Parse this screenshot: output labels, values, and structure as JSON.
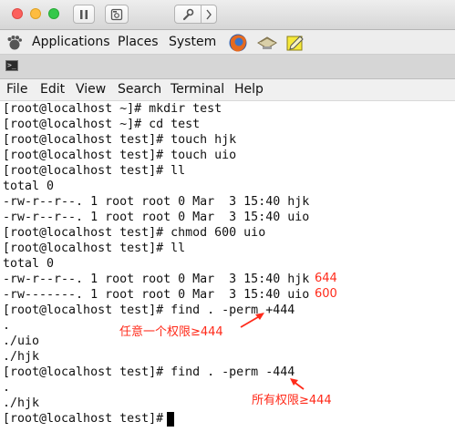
{
  "panel": {
    "applications": "Applications",
    "places": "Places",
    "system": "System"
  },
  "menu": [
    "File",
    "Edit",
    "View",
    "Search",
    "Terminal",
    "Help"
  ],
  "terminal_lines": [
    "[root@localhost ~]# mkdir test",
    "[root@localhost ~]# cd test",
    "[root@localhost test]# touch hjk",
    "[root@localhost test]# touch uio",
    "[root@localhost test]# ll",
    "total 0",
    "-rw-r--r--. 1 root root 0 Mar  3 15:40 hjk",
    "-rw-r--r--. 1 root root 0 Mar  3 15:40 uio",
    "[root@localhost test]# chmod 600 uio",
    "[root@localhost test]# ll",
    "total 0",
    "-rw-r--r--. 1 root root 0 Mar  3 15:40 hjk",
    "-rw-------. 1 root root 0 Mar  3 15:40 uio",
    "[root@localhost test]# find . -perm +444",
    ".",
    "./uio",
    "./hjk",
    "[root@localhost test]# find . -perm -444",
    ".",
    "./hjk",
    "[root@localhost test]# "
  ],
  "annotations": {
    "perm_hjk": "644",
    "perm_uio": "600",
    "any_perm": "任意一个权限≥444",
    "all_perm": "所有权限≥444"
  },
  "colors": {
    "annotation": "#ff2a1a",
    "terminal_bg": "#ffffff",
    "terminal_fg": "#111111"
  }
}
